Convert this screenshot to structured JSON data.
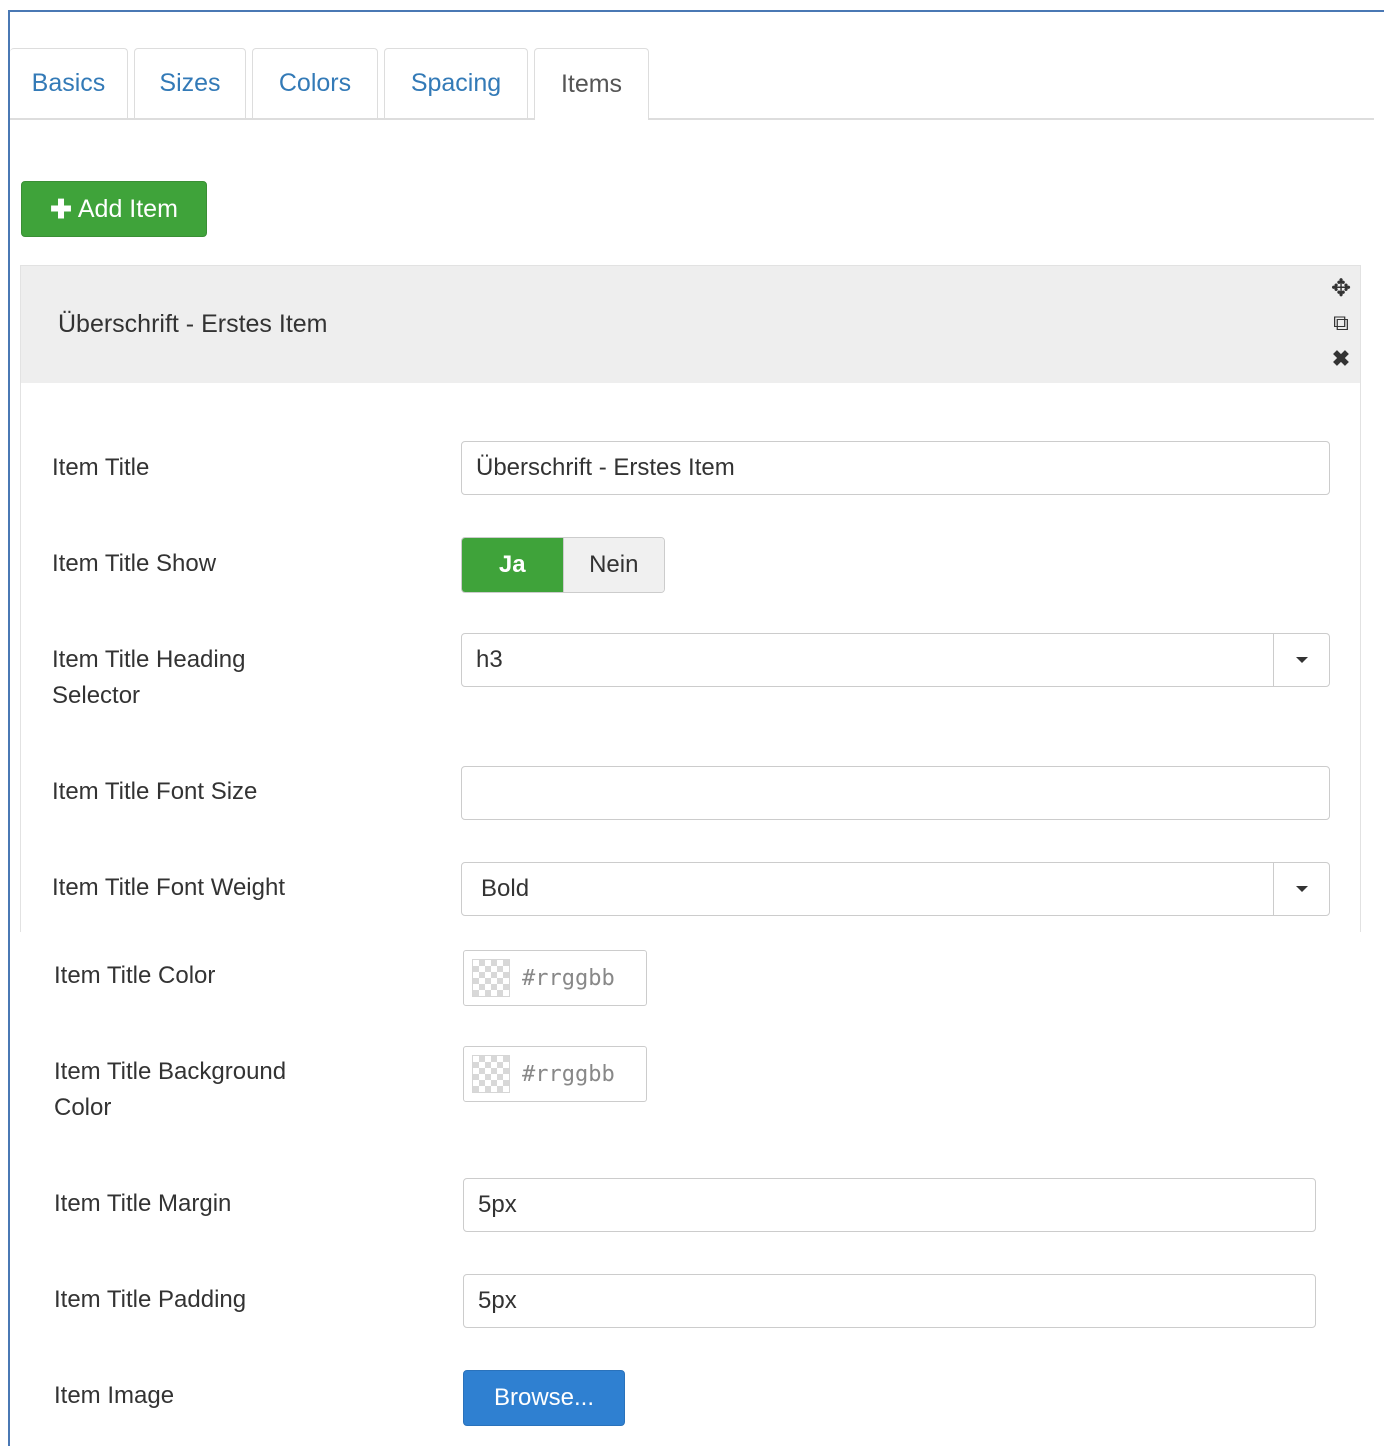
{
  "tabs": [
    {
      "label": "Basics"
    },
    {
      "label": "Sizes"
    },
    {
      "label": "Colors"
    },
    {
      "label": "Spacing"
    },
    {
      "label": "Items"
    }
  ],
  "toolbar": {
    "add_item_label": "Add Item",
    "add_icon": "plus-icon"
  },
  "item_panel": {
    "title": "Überschrift - Erstes Item",
    "controls": {
      "move_icon": "move-icon",
      "copy_icon": "copy-icon",
      "close_icon": "close-icon"
    }
  },
  "fields": {
    "item_title": {
      "label": "Item Title",
      "value": "Überschrift - Erstes Item"
    },
    "item_title_show": {
      "label": "Item Title Show",
      "on_label": "Ja",
      "off_label": "Nein",
      "selected": "Ja"
    },
    "heading_selector": {
      "label_line1": "Item Title Heading",
      "label_line2": "Selector",
      "value": "h3"
    },
    "font_size": {
      "label": "Item Title Font Size",
      "value": ""
    },
    "font_weight": {
      "label": "Item Title Font Weight",
      "value": "Bold"
    },
    "title_color": {
      "label": "Item Title Color",
      "placeholder": "#rrggbb"
    },
    "title_bg_color": {
      "label_line1": "Item Title Background",
      "label_line2": "Color",
      "placeholder": "#rrggbb"
    },
    "title_margin": {
      "label": "Item Title Margin",
      "value": "5px"
    },
    "title_padding": {
      "label": "Item Title Padding",
      "value": "5px"
    },
    "item_image": {
      "label": "Item Image",
      "button_label": "Browse..."
    }
  },
  "colors": {
    "accent_green": "#3fa33a",
    "link_blue": "#337ab7",
    "browse_blue": "#2f80d1",
    "frame_blue": "#4a78b4"
  }
}
